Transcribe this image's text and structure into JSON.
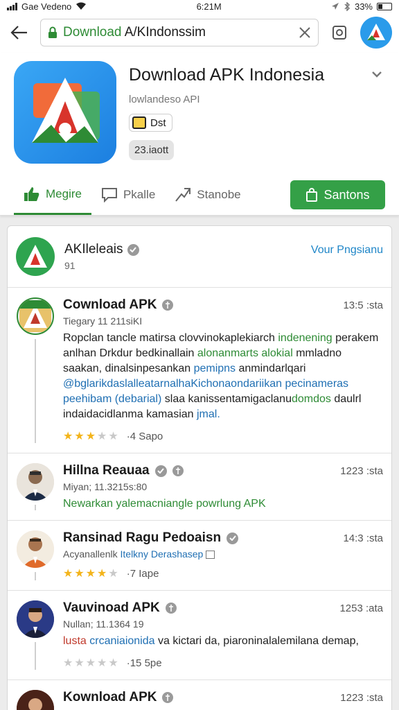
{
  "status": {
    "carrier": "Gae Vedeno",
    "time": "6:21M",
    "battery": "33%"
  },
  "toolbar": {
    "url_highlight": "Download",
    "url_rest": " A/KIndonssim"
  },
  "app": {
    "title": "Download APK Indonesia",
    "subtitle": "lowlandeso API",
    "badge_label": "Dst",
    "size_label": "23.iaott",
    "actions": [
      {
        "label": "Megire",
        "active": true
      },
      {
        "label": "Pkalle",
        "active": false
      },
      {
        "label": "Stanobe",
        "active": false
      }
    ],
    "primary_label": "Santons",
    "accent_color": "#34a047"
  },
  "channel": {
    "name": "AKIleleais",
    "count": "91",
    "link": "Vour Pngsianu"
  },
  "posts": [
    {
      "name": "Cownload APK",
      "time": "13:5 :sta",
      "meta": "Tiegary 11 211siKI",
      "text_parts": [
        {
          "t": "Ropclan tancle matirsa clovvinokaplekiarch ",
          "c": ""
        },
        {
          "t": "indenening",
          "c": "g"
        },
        {
          "t": " perakem anlhan Drkdur bedkinallain ",
          "c": ""
        },
        {
          "t": "alonanmarts alokial",
          "c": "g"
        },
        {
          "t": " mmladno saakan, dinalsinpesankan ",
          "c": ""
        },
        {
          "t": "pemipns",
          "c": "b"
        },
        {
          "t": " anmindarlqari ",
          "c": ""
        },
        {
          "t": "@bglarikdaslalleatarnalhaKichonaondariikan pecinameras peehibam (debarial)",
          "c": "b"
        },
        {
          "t": " slaa kanissentamigaclanu",
          "c": ""
        },
        {
          "t": "domdos",
          "c": "g"
        },
        {
          "t": " daulrl indaidacidlanma kamasian ",
          "c": ""
        },
        {
          "t": "jmal.",
          "c": "b"
        }
      ],
      "stars_on": 3,
      "stars_total": 5,
      "star_count": "·4 Sapo"
    },
    {
      "name": "Hillna Reauaa",
      "time": "1223 :sta",
      "meta": "Miyan; 11.3215s:80",
      "reply": "Newarkan yalemacniangle powrlung APK",
      "reply_color": "g"
    },
    {
      "name": "Ransinad Ragu Pedoaisn",
      "time": "14:3 :sta",
      "meta": "Acyanallenlk",
      "meta_link": "Itelkny Derashasep",
      "stars_on": 4,
      "stars_total": 5,
      "star_count": "·7 Iape"
    },
    {
      "name": "Vauvinoad APK",
      "time": "1253 :ata",
      "meta": "Nullan; 11.1364 19",
      "reply_lead": "lusta",
      "reply_lead2": "crcaniaionida",
      "reply_rest": " va kictari da, piaroninalalemilana demap,",
      "stars_on": 0,
      "stars_total": 5,
      "star_count": "·15 5pe"
    },
    {
      "name": "Kownload APK",
      "time": "1223 :sta"
    }
  ]
}
